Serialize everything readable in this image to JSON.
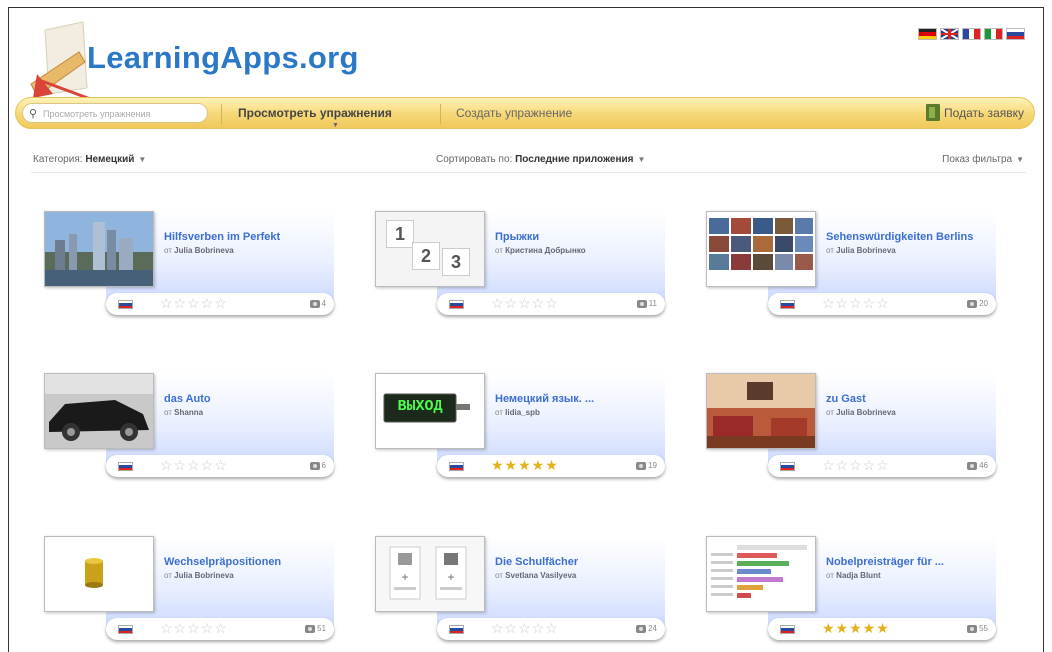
{
  "header": {
    "logo_text": "LearningApps.org",
    "languages": [
      "de",
      "en",
      "fr",
      "it",
      "ru"
    ]
  },
  "nav": {
    "search_placeholder": "Просмотреть упражнения",
    "browse_label": "Просмотреть упражнения",
    "create_label": "Создать упражнение",
    "submit_label": "Подать заявку"
  },
  "filters": {
    "category_label": "Категория:",
    "category_value": "Немецкий",
    "sort_label": "Сортировать по:",
    "sort_value": "Последние приложения",
    "filter_toggle": "Показ фильтра"
  },
  "apps": [
    {
      "title": "Hilfsverben im Perfekt",
      "author_prefix": "от",
      "author": "Julia Bobrineva",
      "rating": 0,
      "views": "4"
    },
    {
      "title": "Прыжки",
      "author_prefix": "от",
      "author": "Кристина Добрынко",
      "rating": 0,
      "views": "11"
    },
    {
      "title": "Sehenswürdigkeiten Berlins",
      "author_prefix": "от",
      "author": "Julia Bobrineva",
      "rating": 0,
      "views": "20"
    },
    {
      "title": "das Auto",
      "author_prefix": "от",
      "author": "Shanna",
      "rating": 0,
      "views": "6"
    },
    {
      "title": "Немецкий язык. ...",
      "author_prefix": "от",
      "author": "lidia_spb",
      "rating": 5,
      "views": "19"
    },
    {
      "title": "zu Gast",
      "author_prefix": "от",
      "author": "Julia Bobrineva",
      "rating": 0,
      "views": "46"
    },
    {
      "title": "Wechselpräpositionen",
      "author_prefix": "от",
      "author": "Julia Bobrineva",
      "rating": 0,
      "views": "51"
    },
    {
      "title": "Die Schulfächer",
      "author_prefix": "от",
      "author": "Svetlana Vasilyeva",
      "rating": 0,
      "views": "24"
    },
    {
      "title": "Nobelpreisträger für ...",
      "author_prefix": "от",
      "author": "Nadja Blunt",
      "rating": 5,
      "views": "55"
    }
  ],
  "thumb_texts": {
    "numbers": [
      "1",
      "2",
      "3"
    ],
    "exit_sign": "ВЫХОД"
  }
}
